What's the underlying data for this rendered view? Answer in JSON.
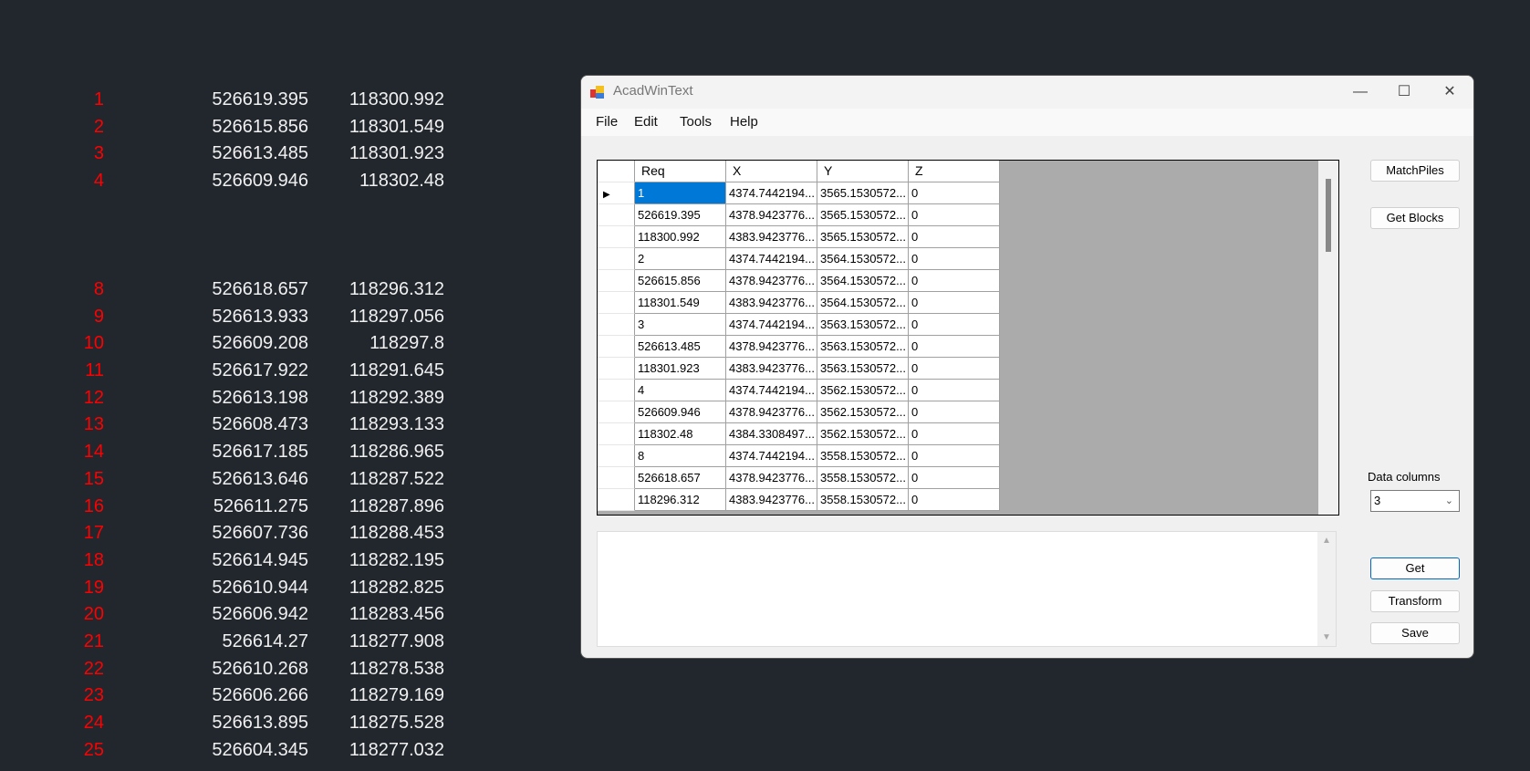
{
  "background_list": [
    {
      "n": "1",
      "x": "526619.395",
      "y": "118300.992"
    },
    {
      "n": "2",
      "x": "526615.856",
      "y": "118301.549"
    },
    {
      "n": "3",
      "x": "526613.485",
      "y": "118301.923"
    },
    {
      "n": "4",
      "x": "526609.946",
      "y": "118302.48"
    },
    {
      "n": "8",
      "x": "526618.657",
      "y": "118296.312"
    },
    {
      "n": "9",
      "x": "526613.933",
      "y": "118297.056"
    },
    {
      "n": "10",
      "x": "526609.208",
      "y": "118297.8"
    },
    {
      "n": "11",
      "x": "526617.922",
      "y": "118291.645"
    },
    {
      "n": "12",
      "x": "526613.198",
      "y": "118292.389"
    },
    {
      "n": "13",
      "x": "526608.473",
      "y": "118293.133"
    },
    {
      "n": "14",
      "x": "526617.185",
      "y": "118286.965"
    },
    {
      "n": "15",
      "x": "526613.646",
      "y": "118287.522"
    },
    {
      "n": "16",
      "x": "526611.275",
      "y": "118287.896"
    },
    {
      "n": "17",
      "x": "526607.736",
      "y": "118288.453"
    },
    {
      "n": "18",
      "x": "526614.945",
      "y": "118282.195"
    },
    {
      "n": "19",
      "x": "526610.944",
      "y": "118282.825"
    },
    {
      "n": "20",
      "x": "526606.942",
      "y": "118283.456"
    },
    {
      "n": "21",
      "x": "526614.27",
      "y": "118277.908"
    },
    {
      "n": "22",
      "x": "526610.268",
      "y": "118278.538"
    },
    {
      "n": "23",
      "x": "526606.266",
      "y": "118279.169"
    },
    {
      "n": "24",
      "x": "526613.895",
      "y": "118275.528"
    },
    {
      "n": "25",
      "x": "526604.345",
      "y": "118277.032"
    }
  ],
  "window": {
    "title": "AcadWinText",
    "controls": {
      "minimize": "—",
      "maximize": "☐",
      "close": "✕"
    },
    "menu": [
      "File",
      "Edit",
      "Tools",
      "Help"
    ],
    "grid": {
      "columns": [
        "Req",
        "X",
        "Y",
        "Z"
      ],
      "rows": [
        [
          "1",
          "4374.7442194...",
          "3565.1530572...",
          "0"
        ],
        [
          "526619.395",
          "4378.9423776...",
          "3565.1530572...",
          "0"
        ],
        [
          "118300.992",
          "4383.9423776...",
          "3565.1530572...",
          "0"
        ],
        [
          "2",
          "4374.7442194...",
          "3564.1530572...",
          "0"
        ],
        [
          "526615.856",
          "4378.9423776...",
          "3564.1530572...",
          "0"
        ],
        [
          "118301.549",
          "4383.9423776...",
          "3564.1530572...",
          "0"
        ],
        [
          "3",
          "4374.7442194...",
          "3563.1530572...",
          "0"
        ],
        [
          "526613.485",
          "4378.9423776...",
          "3563.1530572...",
          "0"
        ],
        [
          "118301.923",
          "4383.9423776...",
          "3563.1530572...",
          "0"
        ],
        [
          "4",
          "4374.7442194...",
          "3562.1530572...",
          "0"
        ],
        [
          "526609.946",
          "4378.9423776...",
          "3562.1530572...",
          "0"
        ],
        [
          "118302.48",
          "4384.3308497...",
          "3562.1530572...",
          "0"
        ],
        [
          "8",
          "4374.7442194...",
          "3558.1530572...",
          "0"
        ],
        [
          "526618.657",
          "4378.9423776...",
          "3558.1530572...",
          "0"
        ],
        [
          "118296.312",
          "4383.9423776...",
          "3558.1530572...",
          "0"
        ]
      ]
    },
    "buttons": {
      "matchpiles": "MatchPiles",
      "get_blocks": "Get Blocks",
      "get": "Get",
      "transform": "Transform",
      "save": "Save"
    },
    "data_columns": {
      "label": "Data columns",
      "value": "3"
    },
    "output_text": ""
  }
}
